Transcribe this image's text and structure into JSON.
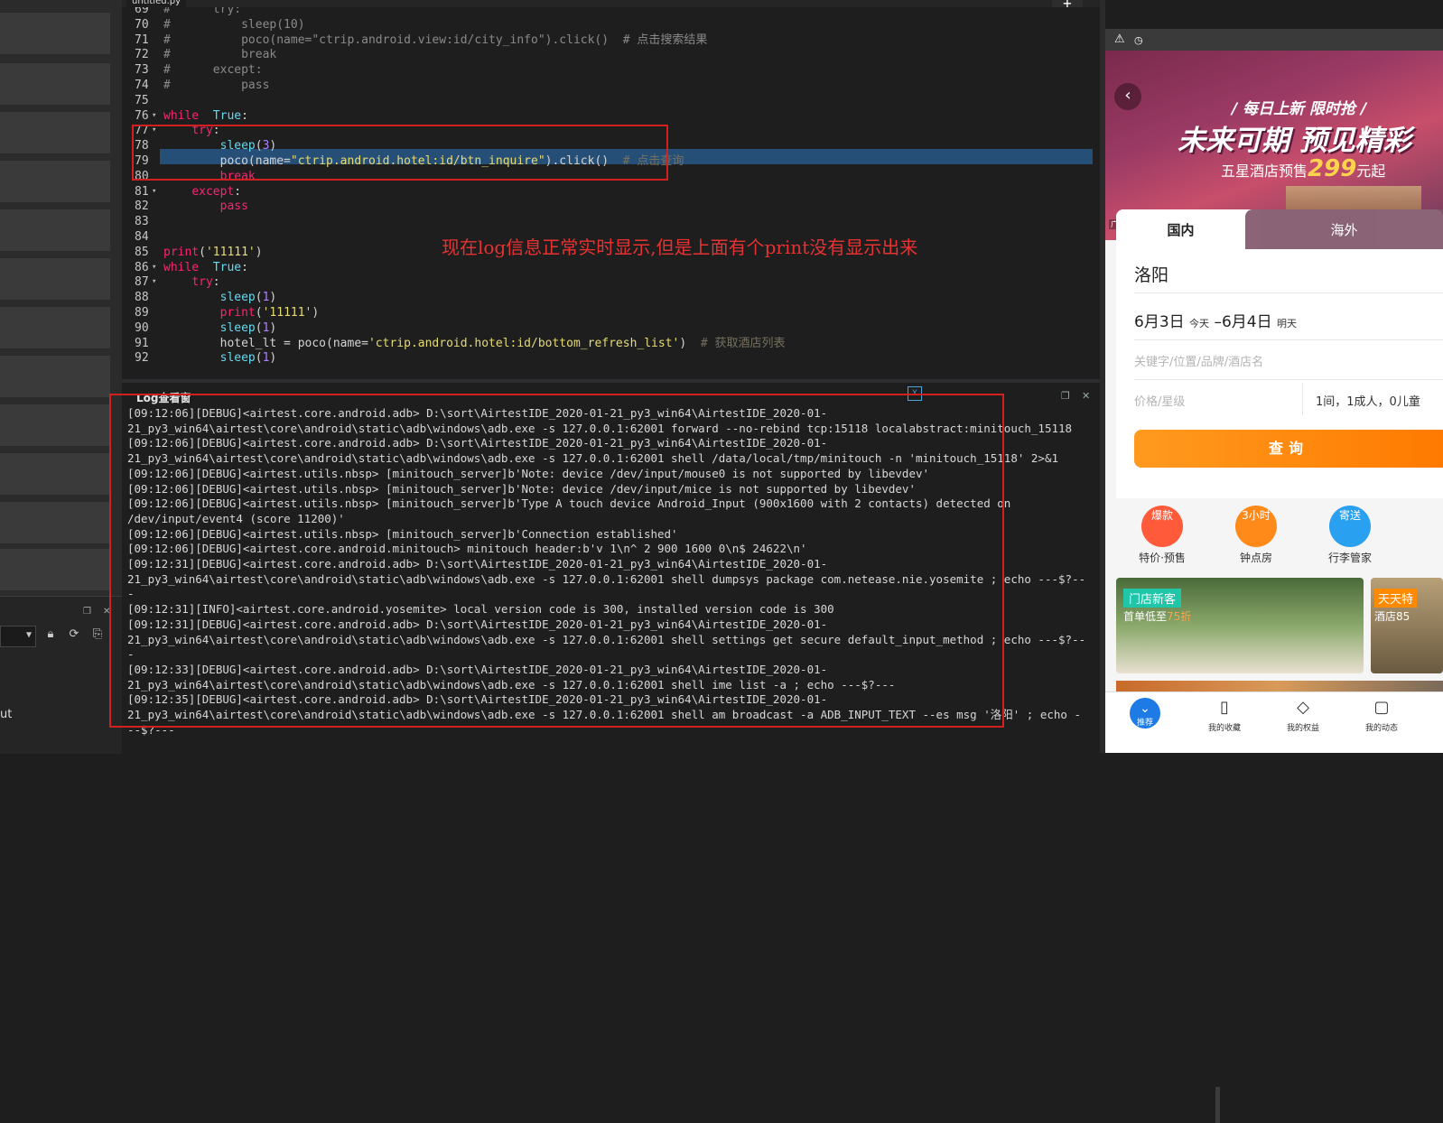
{
  "left_panel": {
    "bottom_label": "ut",
    "dropdown_arrow": "caret-down-icon"
  },
  "editor": {
    "tab_title": "untitled.py",
    "plus_label": "+"
  },
  "code_lines": [
    {
      "n": "69",
      "fold": "",
      "segs": [
        [
          "cm2",
          "#      try:"
        ]
      ]
    },
    {
      "n": "70",
      "fold": "",
      "segs": [
        [
          "cm2",
          "#          sleep(10)"
        ]
      ]
    },
    {
      "n": "71",
      "fold": "",
      "segs": [
        [
          "cm2",
          "#          poco(name=\"ctrip.android.view:id/city_info\").click()  # 点击搜索结果"
        ]
      ]
    },
    {
      "n": "72",
      "fold": "",
      "segs": [
        [
          "cm2",
          "#          break"
        ]
      ]
    },
    {
      "n": "73",
      "fold": "",
      "segs": [
        [
          "cm2",
          "#      except:"
        ]
      ]
    },
    {
      "n": "74",
      "fold": "",
      "segs": [
        [
          "cm2",
          "#          pass"
        ]
      ]
    },
    {
      "n": "75",
      "fold": "",
      "segs": []
    },
    {
      "n": "76",
      "fold": "▾",
      "segs": [
        [
          "kw",
          "while"
        ],
        [
          "",
          "  "
        ],
        [
          "fn",
          "True"
        ],
        [
          "",
          ":"
        ]
      ]
    },
    {
      "n": "77",
      "fold": "▾",
      "segs": [
        [
          "",
          "    "
        ],
        [
          "kw",
          "try"
        ],
        [
          "",
          ":"
        ]
      ]
    },
    {
      "n": "78",
      "fold": "",
      "segs": [
        [
          "",
          "        "
        ],
        [
          "fn",
          "sleep"
        ],
        [
          "",
          "("
        ],
        [
          "num",
          "3"
        ],
        [
          "",
          ")"
        ]
      ]
    },
    {
      "n": "79",
      "fold": "",
      "segs": [
        [
          "",
          "        poco(name="
        ],
        [
          "str",
          "\"ctrip.android.hotel:id/btn_inquire\""
        ],
        [
          "",
          ").click()  "
        ],
        [
          "cm",
          "# 点击查询"
        ]
      ]
    },
    {
      "n": "80",
      "fold": "",
      "segs": [
        [
          "",
          "        "
        ],
        [
          "kw",
          "break"
        ]
      ]
    },
    {
      "n": "81",
      "fold": "▾",
      "segs": [
        [
          "",
          "    "
        ],
        [
          "kw",
          "except"
        ],
        [
          "",
          ":"
        ]
      ]
    },
    {
      "n": "82",
      "fold": "",
      "segs": [
        [
          "",
          "        "
        ],
        [
          "kw",
          "pass"
        ]
      ]
    },
    {
      "n": "83",
      "fold": "",
      "segs": []
    },
    {
      "n": "84",
      "fold": "",
      "segs": []
    },
    {
      "n": "85",
      "fold": "",
      "segs": [
        [
          "kw",
          "print"
        ],
        [
          "",
          "("
        ],
        [
          "str",
          "'11111'"
        ],
        [
          "",
          ")"
        ]
      ]
    },
    {
      "n": "86",
      "fold": "▾",
      "segs": [
        [
          "kw",
          "while"
        ],
        [
          "",
          "  "
        ],
        [
          "fn",
          "True"
        ],
        [
          "",
          ":"
        ]
      ]
    },
    {
      "n": "87",
      "fold": "▾",
      "segs": [
        [
          "",
          "    "
        ],
        [
          "kw",
          "try"
        ],
        [
          "",
          ":"
        ]
      ]
    },
    {
      "n": "88",
      "fold": "",
      "segs": [
        [
          "",
          "        "
        ],
        [
          "fn",
          "sleep"
        ],
        [
          "",
          "("
        ],
        [
          "num",
          "1"
        ],
        [
          "",
          ")"
        ]
      ]
    },
    {
      "n": "89",
      "fold": "",
      "segs": [
        [
          "",
          "        "
        ],
        [
          "kw",
          "print"
        ],
        [
          "",
          "("
        ],
        [
          "str",
          "'11111'"
        ],
        [
          "",
          ")"
        ]
      ]
    },
    {
      "n": "90",
      "fold": "",
      "segs": [
        [
          "",
          "        "
        ],
        [
          "fn",
          "sleep"
        ],
        [
          "",
          "("
        ],
        [
          "num",
          "1"
        ],
        [
          "",
          ")"
        ]
      ]
    },
    {
      "n": "91",
      "fold": "",
      "segs": [
        [
          "",
          "        hotel_lt = poco(name="
        ],
        [
          "str",
          "'ctrip.android.hotel:id/bottom_refresh_list'"
        ],
        [
          "",
          ")  "
        ],
        [
          "cm",
          "# 获取酒店列表"
        ]
      ]
    },
    {
      "n": "92",
      "fold": "",
      "segs": [
        [
          "",
          "        "
        ],
        [
          "fn",
          "sleep"
        ],
        [
          "",
          "("
        ],
        [
          "num",
          "1"
        ],
        [
          "",
          ")"
        ]
      ]
    }
  ],
  "annotation": "现在log信息正常实时显示,但是上面有个print没有显示出来",
  "log": {
    "title": "Log查看窗",
    "lines": [
      "[09:12:06][DEBUG]<airtest.core.android.adb> D:\\sort\\AirtestIDE_2020-01-21_py3_win64\\AirtestIDE_2020-01-",
      "21_py3_win64\\airtest\\core\\android\\static\\adb\\windows\\adb.exe -s 127.0.0.1:62001 forward --no-rebind tcp:15118 localabstract:minitouch_15118",
      "[09:12:06][DEBUG]<airtest.core.android.adb> D:\\sort\\AirtestIDE_2020-01-21_py3_win64\\AirtestIDE_2020-01-",
      "21_py3_win64\\airtest\\core\\android\\static\\adb\\windows\\adb.exe -s 127.0.0.1:62001 shell /data/local/tmp/minitouch -n 'minitouch_15118' 2>&1",
      "[09:12:06][DEBUG]<airtest.utils.nbsp> [minitouch_server]b'Note: device /dev/input/mouse0 is not supported by libevdev'",
      "[09:12:06][DEBUG]<airtest.utils.nbsp> [minitouch_server]b'Note: device /dev/input/mice is not supported by libevdev'",
      "[09:12:06][DEBUG]<airtest.utils.nbsp> [minitouch_server]b'Type A touch device Android_Input (900x1600 with 2 contacts) detected on",
      "/dev/input/event4 (score 11200)'",
      "[09:12:06][DEBUG]<airtest.utils.nbsp> [minitouch_server]b'Connection established'",
      "[09:12:06][DEBUG]<airtest.core.android.minitouch> minitouch header:b'v 1\\n^ 2 900 1600 0\\n$ 24622\\n'",
      "[09:12:31][DEBUG]<airtest.core.android.adb> D:\\sort\\AirtestIDE_2020-01-21_py3_win64\\AirtestIDE_2020-01-",
      "21_py3_win64\\airtest\\core\\android\\static\\adb\\windows\\adb.exe -s 127.0.0.1:62001 shell dumpsys package com.netease.nie.yosemite ; echo ---$?--",
      "-",
      "[09:12:31][INFO]<airtest.core.android.yosemite> local version code is 300, installed version code is 300",
      "[09:12:31][DEBUG]<airtest.core.android.adb> D:\\sort\\AirtestIDE_2020-01-21_py3_win64\\AirtestIDE_2020-01-",
      "21_py3_win64\\airtest\\core\\android\\static\\adb\\windows\\adb.exe -s 127.0.0.1:62001 shell settings get secure default_input_method ; echo ---$?--",
      "-",
      "[09:12:33][DEBUG]<airtest.core.android.adb> D:\\sort\\AirtestIDE_2020-01-21_py3_win64\\AirtestIDE_2020-01-",
      "21_py3_win64\\airtest\\core\\android\\static\\adb\\windows\\adb.exe -s 127.0.0.1:62001 shell ime list -a ; echo ---$?---",
      "[09:12:35][DEBUG]<airtest.core.android.adb> D:\\sort\\AirtestIDE_2020-01-21_py3_win64\\AirtestIDE_2020-01-",
      "21_py3_win64\\airtest\\core\\android\\static\\adb\\windows\\adb.exe -s 127.0.0.1:62001 shell am broadcast -a ADB_INPUT_TEXT --es msg '洛阳' ; echo -",
      "--$?---"
    ]
  },
  "phone": {
    "banner_sub": "/ 每日上新 限时抢 /",
    "banner_main": "未来可期 预见精彩",
    "banner_line_pre": "五星酒店预售",
    "banner_price": "299",
    "banner_line_post": "元起",
    "banner_ad": "广告",
    "tab_domestic": "国内",
    "tab_overseas": "海外",
    "city": "洛阳",
    "date_in": "6月3日",
    "date_in_note": "今天",
    "date_sep": " –",
    "date_out": "6月4日",
    "date_out_note": "明天",
    "keyword_placeholder": "关键字/位置/品牌/酒店名",
    "price_placeholder": "价格/星级",
    "guests": "1间，1成人，0儿童",
    "search_label": "查询",
    "icons": [
      {
        "label": "特价·预售",
        "badge": "爆款",
        "color": "#ff5a3a"
      },
      {
        "label": "钟点房",
        "badge": "3小时",
        "color": "#ff8a1a"
      },
      {
        "label": "行李管家",
        "badge": "寄送",
        "color": "#2aa0f0"
      }
    ],
    "promo1_tag": "门店新客",
    "promo1_sub_pre": "首单低至",
    "promo1_sub_val": "75折",
    "promo2_tag": "天天特",
    "promo2_sub": "酒店85",
    "nav": [
      {
        "label": "推荐",
        "icon": "heart-icon"
      },
      {
        "label": "我的收藏",
        "icon": "bookmark-icon"
      },
      {
        "label": "我的权益",
        "icon": "diamond-icon"
      },
      {
        "label": "我的动态",
        "icon": "chat-icon"
      }
    ]
  }
}
